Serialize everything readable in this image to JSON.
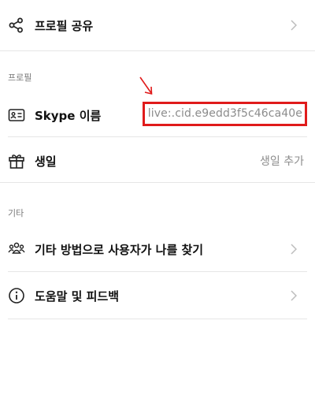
{
  "share_profile": {
    "label": "프로필 공유",
    "icon": "share-icon"
  },
  "section_profile": {
    "title": "프로필"
  },
  "skype_name": {
    "label": "Skype 이름",
    "icon": "id-card-icon",
    "value": "live:.cid.e9edd3f5c46ca40e",
    "highlight_color": "#e01b1b"
  },
  "birthday": {
    "label": "생일",
    "icon": "gift-icon",
    "action": "생일 추가"
  },
  "section_other": {
    "title": "기타"
  },
  "find_other_ways": {
    "label": "기타 방법으로 사용자가 나를 찾기",
    "icon": "people-icon"
  },
  "help_feedback": {
    "label": "도움말 및 피드백",
    "icon": "info-icon"
  },
  "annotation": {
    "arrow_color": "#e01b1b"
  }
}
